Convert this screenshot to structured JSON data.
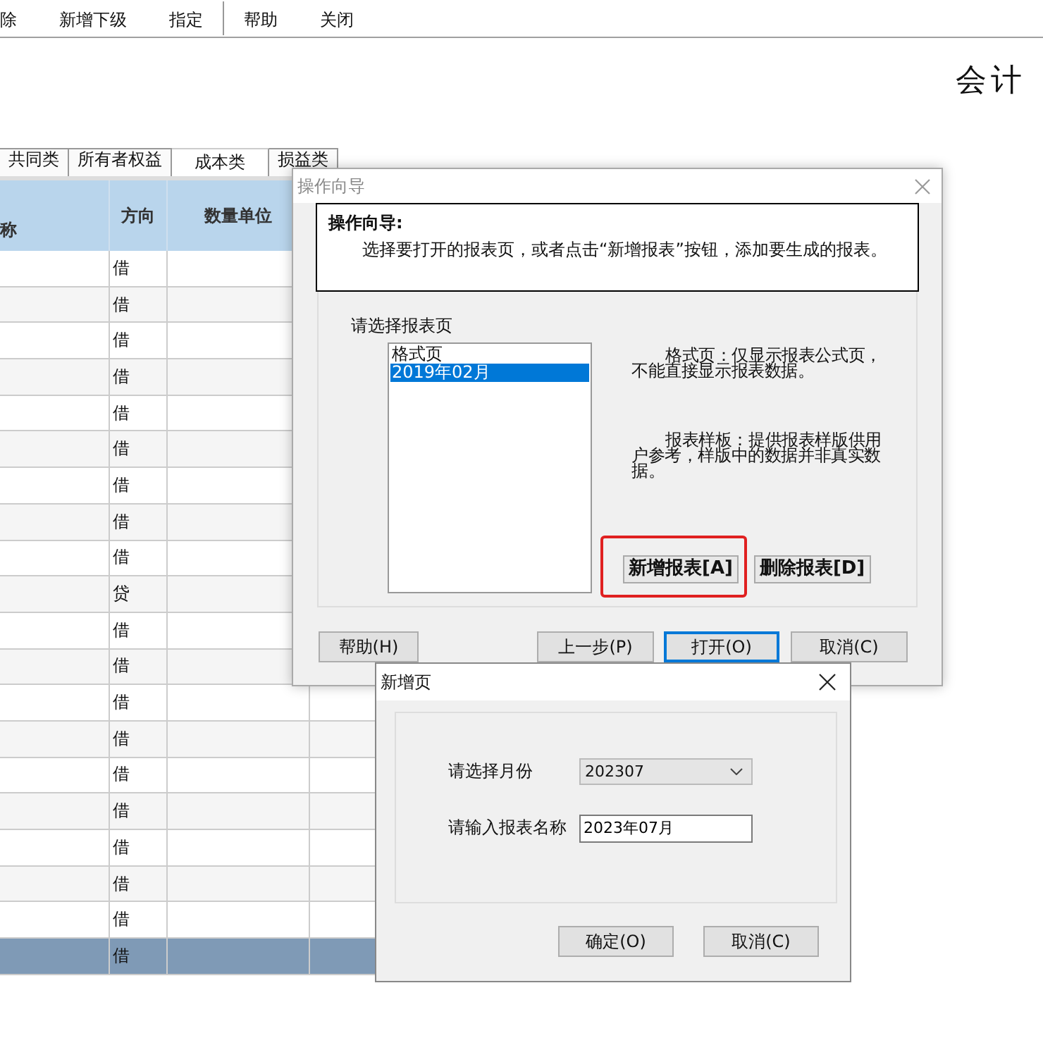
{
  "toolbar": {
    "groups": [
      [
        {
          "label": "除"
        },
        {
          "label": "新增下级"
        },
        {
          "label": "指定"
        }
      ],
      [
        {
          "label": "帮助"
        },
        {
          "label": "关闭"
        }
      ]
    ]
  },
  "page_title": "会计",
  "tabs": [
    {
      "label": "共同类",
      "selected": false
    },
    {
      "label": "所有者权益",
      "selected": false
    },
    {
      "label": "成本类",
      "selected": true
    },
    {
      "label": "损益类",
      "selected": false
    }
  ],
  "table": {
    "columns": [
      {
        "label": "称"
      },
      {
        "label": "方向"
      },
      {
        "label": "数量单位"
      }
    ],
    "rows": [
      {
        "direction": "借",
        "selected": false
      },
      {
        "direction": "借",
        "selected": false
      },
      {
        "direction": "借",
        "selected": false
      },
      {
        "direction": "借",
        "selected": false
      },
      {
        "direction": "借",
        "selected": false
      },
      {
        "direction": "借",
        "selected": false
      },
      {
        "direction": "借",
        "selected": false
      },
      {
        "direction": "借",
        "selected": false
      },
      {
        "direction": "借",
        "selected": false
      },
      {
        "direction": "贷",
        "selected": false
      },
      {
        "direction": "借",
        "selected": false
      },
      {
        "direction": "借",
        "selected": false
      },
      {
        "direction": "借",
        "selected": false
      },
      {
        "direction": "借",
        "selected": false
      },
      {
        "direction": "借",
        "selected": false
      },
      {
        "direction": "借",
        "selected": false
      },
      {
        "direction": "借",
        "selected": false
      },
      {
        "direction": "借",
        "selected": false
      },
      {
        "direction": "借",
        "selected": false
      },
      {
        "direction": "借",
        "selected": true
      }
    ]
  },
  "wizard": {
    "title": "操作向导",
    "heading": "操作向导:",
    "description": "选择要打开的报表页，或者点击“新增报表”按钮，添加要生成的报表。",
    "list_label": "请选择报表页",
    "pages": [
      {
        "label": "格式页",
        "selected": false
      },
      {
        "label": "2019年02月",
        "selected": true
      }
    ],
    "notes": [
      "格式页：仅显示报表公式页，不能直接显示报表数据。",
      "报表样板：提供报表样版供用户参考，样版中的数据并非真实数据。"
    ],
    "add_button": {
      "label": "新增报表[A]",
      "highlighted": true
    },
    "delete_button": {
      "label": "删除报表[D]"
    },
    "buttons": [
      {
        "label": "帮助(H)",
        "focused": false
      },
      {
        "label": "上一步(P)",
        "focused": false
      },
      {
        "label": "打开(O)",
        "focused": true
      },
      {
        "label": "取消(C)",
        "focused": false
      }
    ]
  },
  "new_page_dialog": {
    "title": "新增页",
    "month_label": "请选择月份",
    "month_value": "202307",
    "name_label": "请输入报表名称",
    "name_value": "2023年07月",
    "buttons": [
      {
        "label": "确定(O)"
      },
      {
        "label": "取消(C)"
      }
    ]
  }
}
